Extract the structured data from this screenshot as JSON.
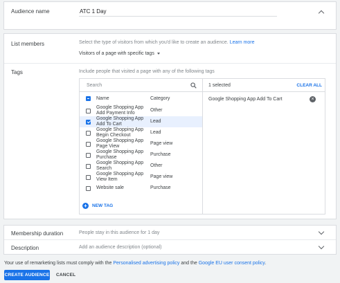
{
  "audience_name": {
    "label": "Audience name",
    "value": "ATC 1 Day"
  },
  "list_members": {
    "label": "List members",
    "hint": "Select the type of visitors from which you'd like to create an audience.",
    "learn_more": "Learn more",
    "select_value": "Visitors of a page with specific tags"
  },
  "tags": {
    "label": "Tags",
    "hint": "Include people that visited a page with any of the following tags",
    "search_placeholder": "Search",
    "col_name": "Name",
    "col_category": "Category",
    "rows": [
      {
        "name": "Google Shopping App Add Payment Info",
        "category": "Other",
        "checked": false
      },
      {
        "name": "Google Shopping App Add To Cart",
        "category": "Lead",
        "checked": true
      },
      {
        "name": "Google Shopping App Begin Checkout",
        "category": "Lead",
        "checked": false
      },
      {
        "name": "Google Shopping App Page View",
        "category": "Page view",
        "checked": false
      },
      {
        "name": "Google Shopping App Purchase",
        "category": "Purchase",
        "checked": false
      },
      {
        "name": "Google Shopping App Search",
        "category": "Other",
        "checked": false
      },
      {
        "name": "Google Shopping App View Item",
        "category": "Page view",
        "checked": false
      },
      {
        "name": "Website sale",
        "category": "Purchase",
        "checked": false
      }
    ],
    "new_tag": "NEW TAG",
    "selected_count": "1 selected",
    "clear_all": "CLEAR ALL",
    "selected_items": [
      "Google Shopping App Add To Cart"
    ]
  },
  "membership": {
    "label": "Membership duration",
    "hint": "People stay in this audience for 1 day"
  },
  "description": {
    "label": "Description",
    "hint": "Add an audience description (optional)"
  },
  "footer": {
    "notice_prefix": "Your use of remarketing lists must comply with the",
    "policy_link": "Personalised advertising policy",
    "notice_mid": "and the",
    "consent_link": "Google EU user consent policy",
    "notice_suffix": ".",
    "create_button": "CREATE AUDIENCE",
    "cancel_button": "CANCEL"
  },
  "colors": {
    "accent": "#1a73e8",
    "selected_row": "#e8f0fe",
    "background": "#f1f3f4"
  }
}
